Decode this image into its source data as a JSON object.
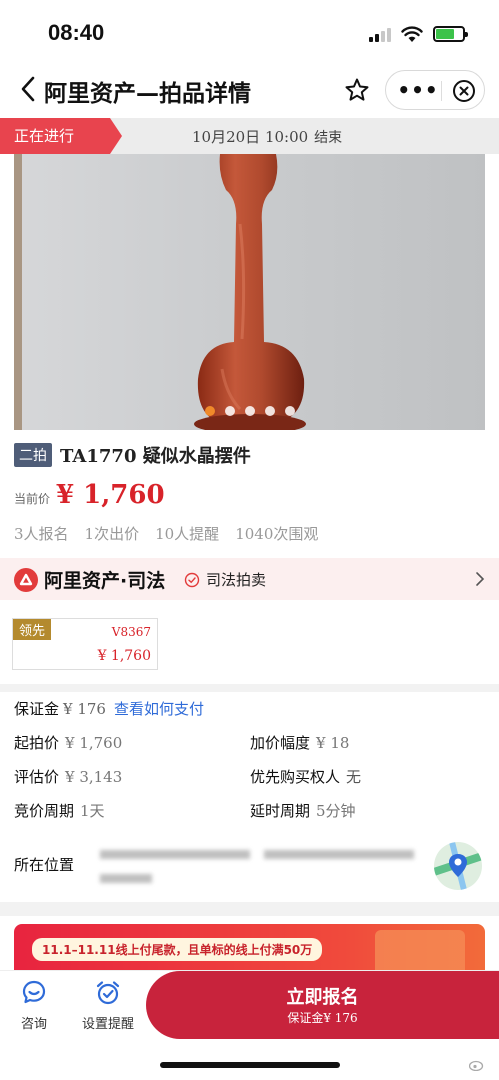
{
  "status_bar": {
    "time": "08:40"
  },
  "nav": {
    "title": "阿里资产—拍品详情",
    "more_label": "•••"
  },
  "auction_status": {
    "tag": "正在进行",
    "end_time": "10月20日 10:00",
    "end_suffix": "结束"
  },
  "gallery": {
    "dot_count": 5,
    "active_dot": 0
  },
  "lot": {
    "round_badge": "二拍",
    "code": "TA1770",
    "name": "疑似水晶摆件",
    "price_label": "当前价",
    "price": "¥ 1,760",
    "stats": [
      "3人报名",
      "1次出价",
      "10人提醒",
      "1040次围观"
    ]
  },
  "court": {
    "brand": "阿里资产·司法",
    "tag": "司法拍卖"
  },
  "leading_bid": {
    "tag": "领先",
    "bidder": "V8367",
    "amount": "¥ 1,760"
  },
  "info": {
    "deposit_label": "保证金",
    "deposit_value": "¥ 176",
    "deposit_link": "查看如何支付",
    "start_price_label": "起拍价",
    "start_price": "¥ 1,760",
    "increment_label": "加价幅度",
    "increment": "¥ 18",
    "appraisal_label": "评估价",
    "appraisal": "¥ 3,143",
    "priority_label": "优先购买权人",
    "priority": "无",
    "cycle_label": "竞价周期",
    "cycle": "1天",
    "delay_label": "延时周期",
    "delay": "5分钟",
    "location_label": "所在位置"
  },
  "promo": {
    "text": "11.1–11.11线上付尾款，且单标的线上付满50万"
  },
  "bottom": {
    "consult_label": "咨询",
    "remind_label": "设置提醒",
    "signup_label": "立即报名",
    "signup_deposit_label": "保证金",
    "signup_deposit": "¥ 176"
  },
  "colors": {
    "accent_red": "#d8232a",
    "signup_red": "#c8233c",
    "lead_gold": "#b48a2e",
    "link_blue": "#2f6bd8"
  }
}
